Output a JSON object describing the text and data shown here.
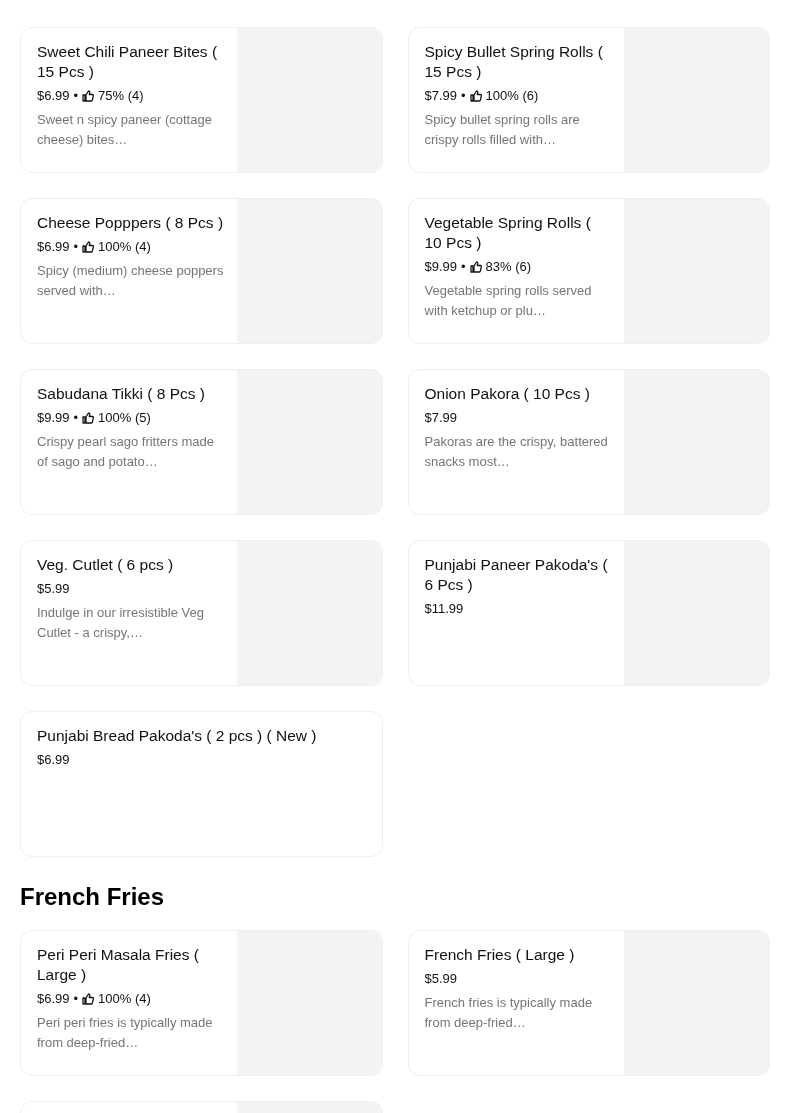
{
  "sections": [
    {
      "items": [
        {
          "name": "Sweet Chili Paneer Bites ( 15 Pcs )",
          "price": "$6.99",
          "separator": "•",
          "rating": "75% (4)",
          "description": "Sweet n spicy paneer (cottage cheese) bites…",
          "thumbnail": {
            "kind": "picture"
          }
        },
        {
          "name": "Spicy Bullet Spring Rolls ( 15 Pcs )",
          "price": "$7.99",
          "separator": "•",
          "rating": "100% (6)",
          "description": "Spicy bullet spring rolls are crispy rolls filled with…",
          "thumbnail": {
            "kind": "picture"
          }
        },
        {
          "name": "Cheese Popppers ( 8 Pcs )",
          "price": "$6.99",
          "separator": "•",
          "rating": "100% (4)",
          "description": "Spicy (medium) cheese poppers served with…",
          "thumbnail": {
            "kind": "picture"
          }
        },
        {
          "name": "Vegetable Spring Rolls ( 10 Pcs )",
          "price": "$9.99",
          "separator": "•",
          "rating": "83% (6)",
          "description": "Vegetable spring rolls served with ketchup or plu…",
          "thumbnail": {
            "kind": "picture"
          }
        },
        {
          "name": "Sabudana Tikki ( 8 Pcs )",
          "price": "$9.99",
          "separator": "•",
          "rating": "100% (5)",
          "description": "Crispy pearl sago fritters made of sago and potato…",
          "thumbnail": {
            "kind": "picture"
          }
        },
        {
          "name": "Onion Pakora ( 10 Pcs )",
          "price": "$7.99",
          "description": "Pakoras are the crispy, battered snacks most…",
          "thumbnail": {
            "kind": "picture"
          }
        },
        {
          "name": "Veg. Cutlet ( 6 pcs )",
          "price": "$5.99",
          "description": "Indulge in our irresistible Veg Cutlet - a crispy,…",
          "thumbnail": {
            "kind": "picture"
          }
        },
        {
          "name": "Punjabi Paneer Pakoda's ( 6 Pcs )",
          "price": "$11.99",
          "thumbnail": {
            "kind": "picture"
          }
        },
        {
          "name": "Punjabi Bread Pakoda's ( 2 pcs ) ( New )",
          "price": "$6.99"
        }
      ]
    },
    {
      "title": "French Fries",
      "items": [
        {
          "name": "Peri Peri Masala Fries ( Large )",
          "price": "$6.99",
          "separator": "•",
          "rating": "100% (4)",
          "description": "Peri peri fries is typically made from deep-fried…",
          "thumbnail": {
            "kind": "picture"
          }
        },
        {
          "name": "French Fries ( Large )",
          "price": "$5.99",
          "description": "French fries is typically made from deep-fried…",
          "thumbnail": {
            "kind": "picture"
          }
        },
        {
          "thumbnail": {
            "kind": "picture"
          }
        }
      ]
    }
  ]
}
